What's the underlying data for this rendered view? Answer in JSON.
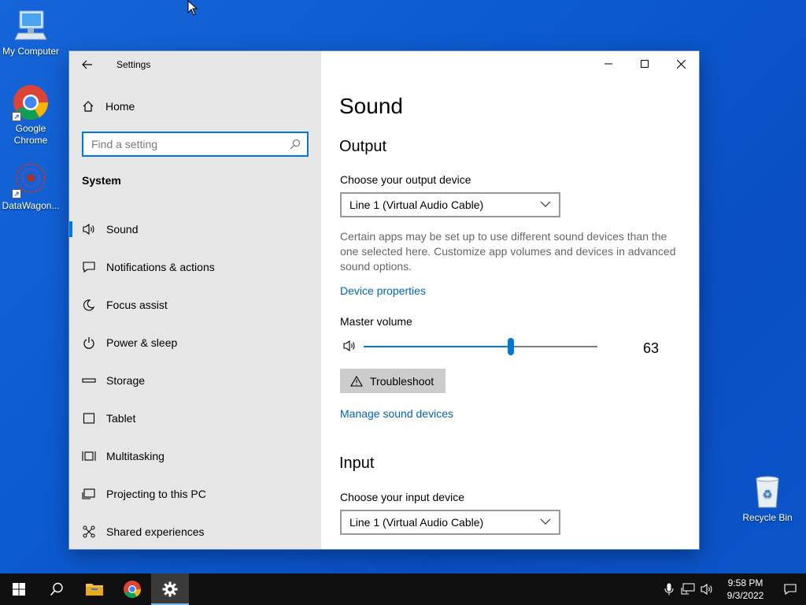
{
  "desktop": {
    "icons": [
      {
        "label": "My Computer"
      },
      {
        "label": "Google Chrome"
      },
      {
        "label": "DataWagon..."
      },
      {
        "label": "Recycle Bin"
      }
    ]
  },
  "window": {
    "title": "Settings",
    "nav": {
      "home": "Home",
      "search_placeholder": "Find a setting",
      "section": "System",
      "items": [
        {
          "label": "Sound",
          "icon": "speaker-icon",
          "selected": true
        },
        {
          "label": "Notifications & actions",
          "icon": "notification-icon"
        },
        {
          "label": "Focus assist",
          "icon": "moon-icon"
        },
        {
          "label": "Power & sleep",
          "icon": "power-icon"
        },
        {
          "label": "Storage",
          "icon": "storage-icon"
        },
        {
          "label": "Tablet",
          "icon": "tablet-icon"
        },
        {
          "label": "Multitasking",
          "icon": "multitasking-icon"
        },
        {
          "label": "Projecting to this PC",
          "icon": "projector-icon"
        },
        {
          "label": "Shared experiences",
          "icon": "share-icon"
        }
      ]
    },
    "content": {
      "title": "Sound",
      "output": {
        "heading": "Output",
        "device_label": "Choose your output device",
        "device_value": "Line 1 (Virtual Audio Cable)",
        "description": "Certain apps may be set up to use different sound devices than the one selected here. Customize app volumes and devices in advanced sound options.",
        "device_properties": "Device properties",
        "master_volume_label": "Master volume",
        "volume": 63,
        "troubleshoot": "Troubleshoot",
        "manage_devices": "Manage sound devices"
      },
      "input": {
        "heading": "Input",
        "device_label": "Choose your input device",
        "device_value": "Line 1 (Virtual Audio Cable)"
      }
    }
  },
  "taskbar": {
    "time": "9:58 PM",
    "date": "9/3/2022"
  },
  "colors": {
    "accent": "#0078d7",
    "link": "#0063b1",
    "taskbar": "#101010"
  }
}
